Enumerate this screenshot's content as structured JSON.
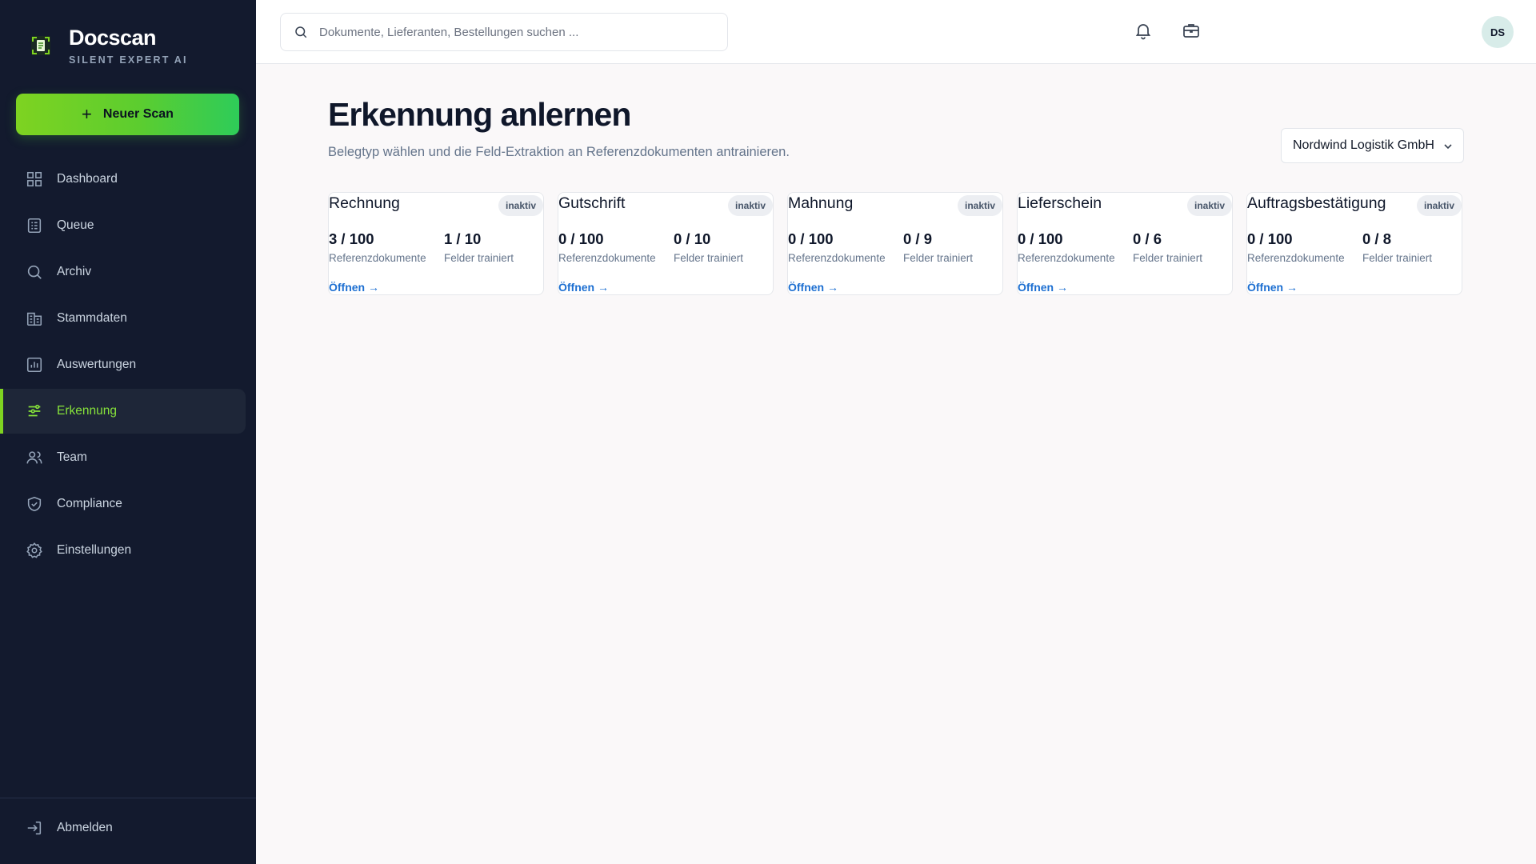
{
  "brand": {
    "name": "Docscan",
    "tagline": "SILENT EXPERT AI",
    "logo_icon": "document-scan-icon"
  },
  "sidebar": {
    "new_scan_label": "Neuer Scan",
    "items": [
      {
        "label": "Dashboard",
        "icon": "grid-icon",
        "active": false
      },
      {
        "label": "Queue",
        "icon": "list-icon",
        "active": false
      },
      {
        "label": "Archiv",
        "icon": "search-icon",
        "active": false
      },
      {
        "label": "Stammdaten",
        "icon": "building-icon",
        "active": false
      },
      {
        "label": "Auswertungen",
        "icon": "chart-icon",
        "active": false
      },
      {
        "label": "Erkennung",
        "icon": "sliders-icon",
        "active": true
      },
      {
        "label": "Team",
        "icon": "users-icon",
        "active": false
      },
      {
        "label": "Compliance",
        "icon": "shield-icon",
        "active": false
      },
      {
        "label": "Einstellungen",
        "icon": "gear-icon",
        "active": false
      }
    ],
    "logout_label": "Abmelden"
  },
  "topbar": {
    "search_placeholder": "Dokumente, Lieferanten, Bestellungen suchen ...",
    "avatar_initials": "DS"
  },
  "main": {
    "title": "Erkennung anlernen",
    "subtitle": "Belegtyp wählen und die Feld-Extraktion an Referenzdokumenten antrainieren.",
    "company": "Nordwind Logistik GmbH",
    "cards": [
      {
        "title": "Rechnung",
        "badge": "inaktiv",
        "docs": "3 / 100",
        "docs_label": "Referenzdokumente",
        "fields": "1 / 10",
        "fields_label": "Felder trainiert",
        "link": "Öffnen →"
      },
      {
        "title": "Gutschrift",
        "badge": "inaktiv",
        "docs": "0 / 100",
        "docs_label": "Referenzdokumente",
        "fields": "0 / 10",
        "fields_label": "Felder trainiert",
        "link": "Öffnen →"
      },
      {
        "title": "Mahnung",
        "badge": "inaktiv",
        "docs": "0 / 100",
        "docs_label": "Referenzdokumente",
        "fields": "0 / 9",
        "fields_label": "Felder trainiert",
        "link": "Öffnen →"
      },
      {
        "title": "Lieferschein",
        "badge": "inaktiv",
        "docs": "0 / 100",
        "docs_label": "Referenzdokumente",
        "fields": "0 / 6",
        "fields_label": "Felder trainiert",
        "link": "Öffnen →"
      },
      {
        "title": "Auftragsbestätigung",
        "badge": "inaktiv",
        "docs": "0 / 100",
        "docs_label": "Referenzdokumente",
        "fields": "0 / 8",
        "fields_label": "Felder trainiert",
        "link": "Öffnen →"
      }
    ]
  },
  "colors": {
    "sidebar_bg": "#131a2e",
    "accent": "#7ed321",
    "link": "#1d6fd1"
  }
}
